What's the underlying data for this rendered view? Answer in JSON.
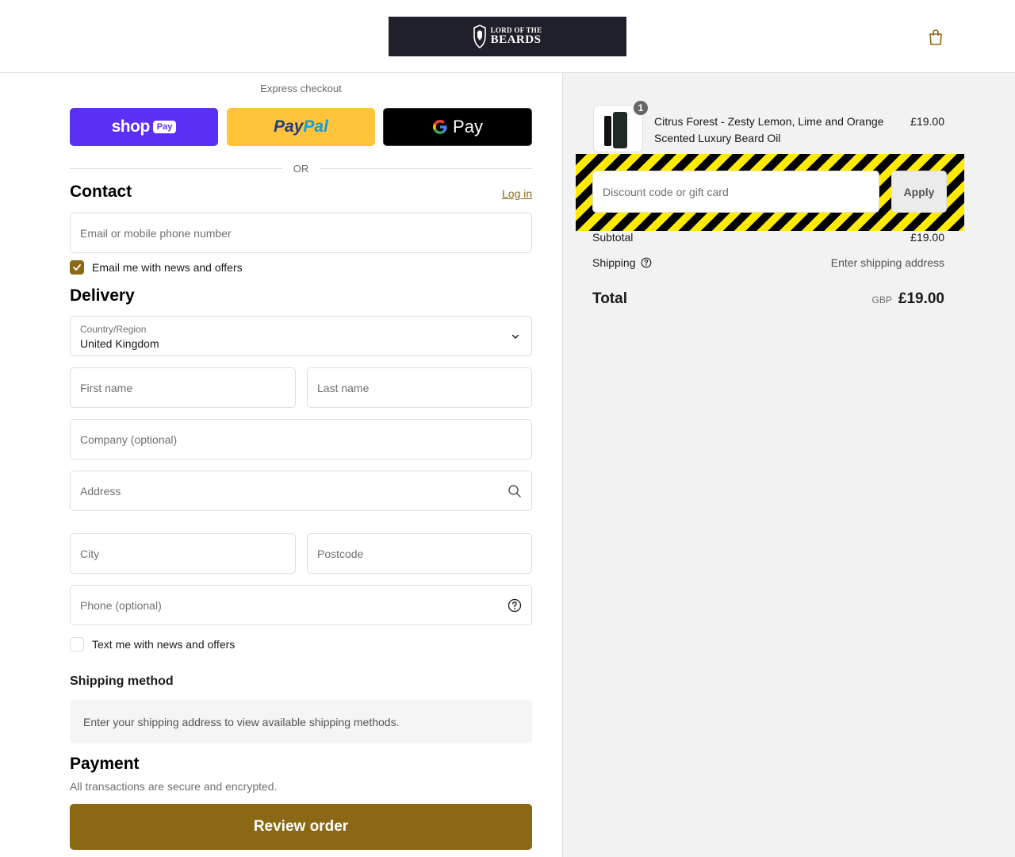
{
  "header": {
    "logo_line1": "LORD OF THE",
    "logo_line2": "BEARDS",
    "cart_icon": "shopping-bag-icon"
  },
  "express": {
    "label": "Express checkout",
    "shop_pay_word": "shop",
    "shop_pay_badge": "Pay",
    "paypal_part1": "Pay",
    "paypal_part2": "Pal",
    "gpay_word": "Pay",
    "or_text": "OR"
  },
  "contact": {
    "title": "Contact",
    "login_link": "Log in",
    "email_placeholder": "Email or mobile phone number",
    "email_offers_label": "Email me with news and offers",
    "email_offers_checked": true
  },
  "delivery": {
    "title": "Delivery",
    "country_label": "Country/Region",
    "country_value": "United Kingdom",
    "first_name_placeholder": "First name",
    "last_name_placeholder": "Last name",
    "company_placeholder": "Company (optional)",
    "address_placeholder": "Address",
    "city_placeholder": "City",
    "postcode_placeholder": "Postcode",
    "phone_placeholder": "Phone (optional)",
    "text_offers_label": "Text me with news and offers",
    "text_offers_checked": false
  },
  "shipping_method": {
    "title": "Shipping method",
    "message": "Enter your shipping address to view available shipping methods."
  },
  "payment": {
    "title": "Payment",
    "subtitle": "All transactions are secure and encrypted.",
    "review_button": "Review order"
  },
  "summary": {
    "item": {
      "quantity": "1",
      "name": "Citrus Forest - Zesty Lemon, Lime and Orange Scented Luxury Beard Oil",
      "price": "£19.00"
    },
    "discount_placeholder": "Discount code or gift card",
    "apply_label": "Apply",
    "subtotal_label": "Subtotal",
    "subtotal_value": "£19.00",
    "shipping_label": "Shipping",
    "shipping_value": "Enter shipping address",
    "total_label": "Total",
    "total_currency": "GBP",
    "total_value": "£19.00"
  },
  "colors": {
    "accent": "#8b6914",
    "shop_pay": "#5a31f4",
    "paypal": "#ffc439",
    "logo_bg": "#20202a"
  }
}
